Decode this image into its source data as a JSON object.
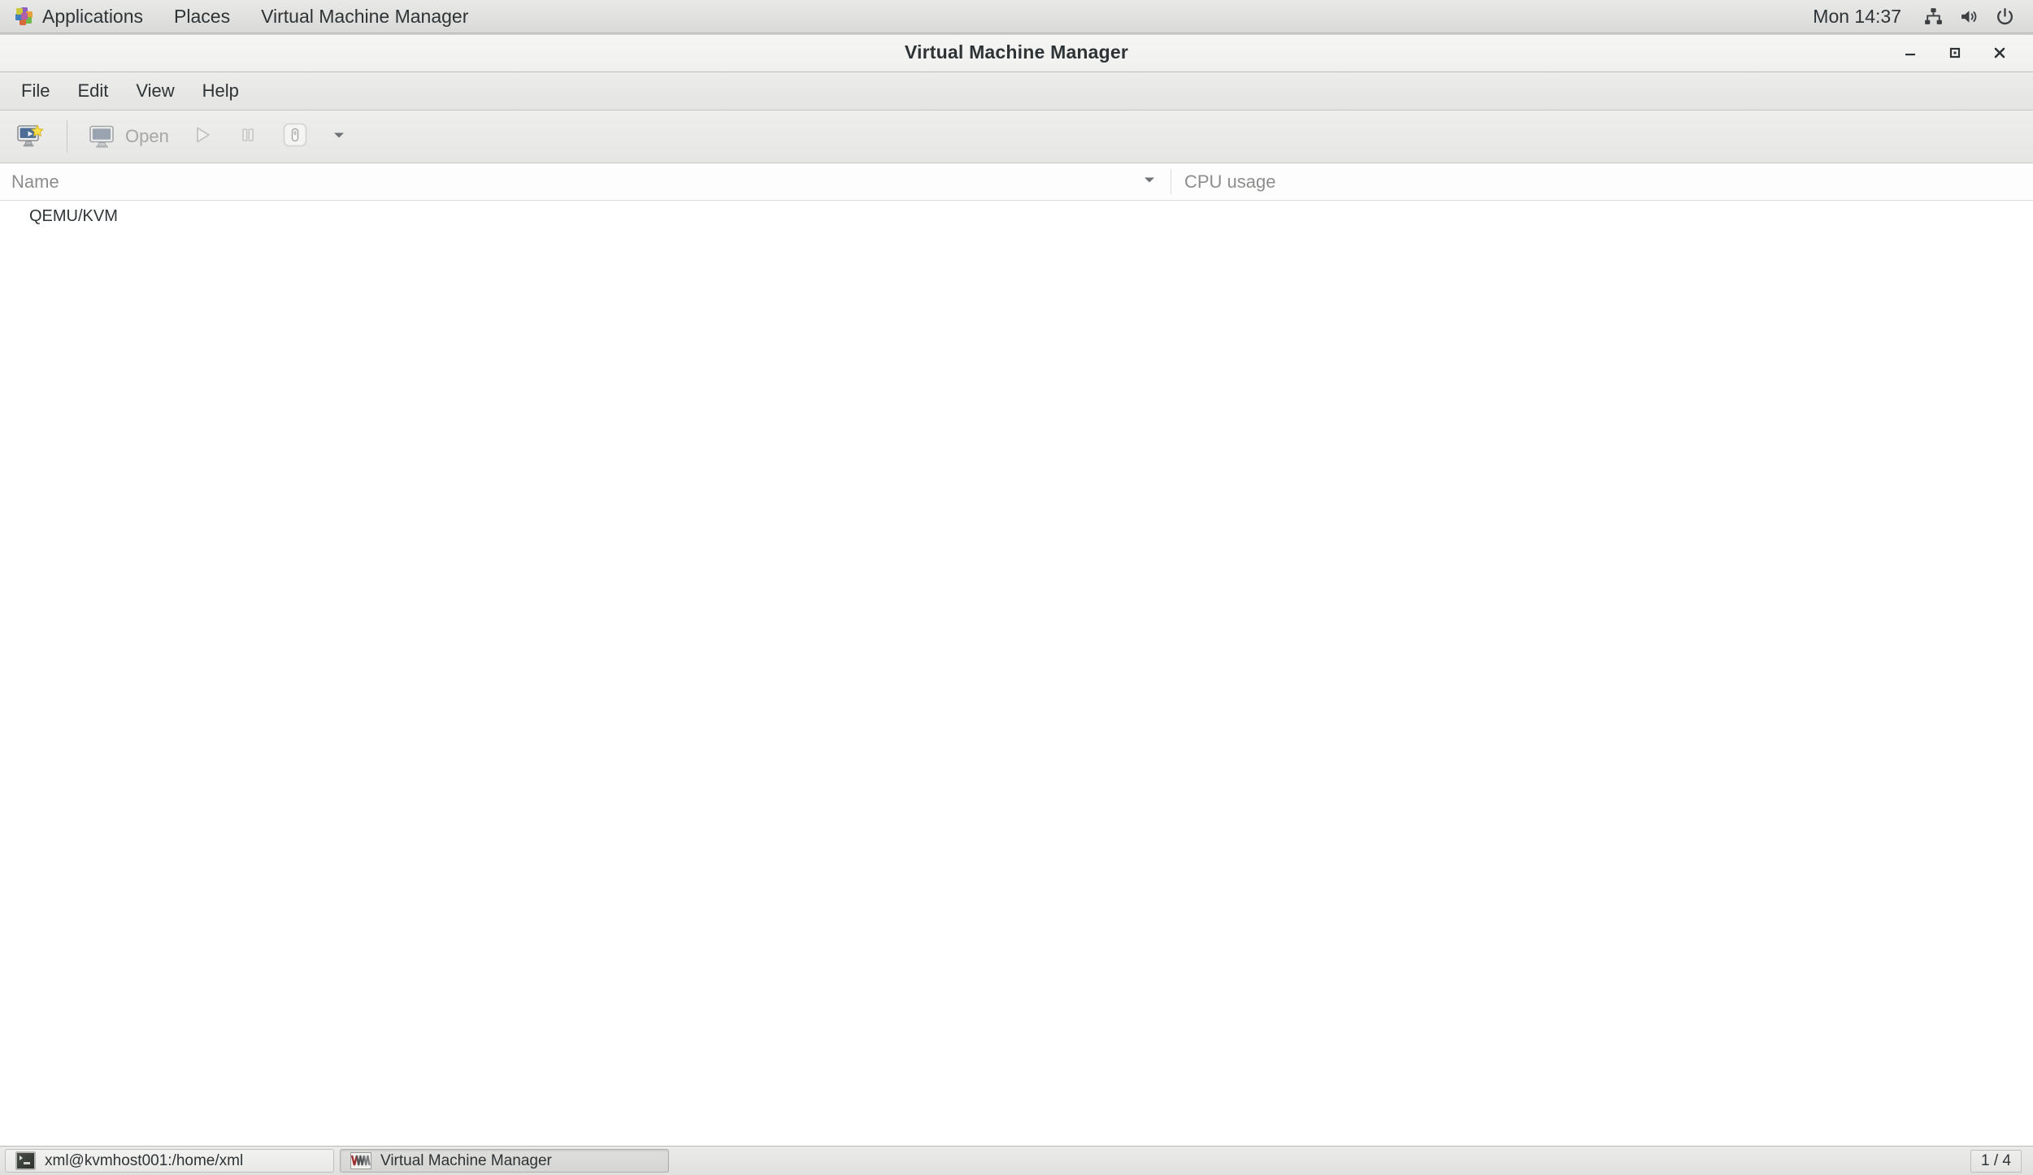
{
  "top_panel": {
    "apps_label": "Applications",
    "places_label": "Places",
    "window_menu_label": "Virtual Machine Manager",
    "clock": "Mon 14:37",
    "tray": [
      {
        "name": "network-icon",
        "title": "Network"
      },
      {
        "name": "volume-icon",
        "title": "Volume"
      },
      {
        "name": "power-icon",
        "title": "Power"
      }
    ]
  },
  "window": {
    "title": "Virtual Machine Manager",
    "controls": {
      "minimize": "Minimize",
      "maximize": "Maximize",
      "close": "Close"
    }
  },
  "menubar": {
    "items": [
      {
        "label": "File"
      },
      {
        "label": "Edit"
      },
      {
        "label": "View"
      },
      {
        "label": "Help"
      }
    ]
  },
  "toolbar": {
    "new_vm_label": "Create a new virtual machine",
    "open_label": "Open",
    "run_label": "Run",
    "pause_label": "Pause",
    "shutdown_label": "Shut down",
    "dropdown_label": "Shutdown options"
  },
  "table": {
    "columns": [
      {
        "label": "Name"
      },
      {
        "label": "CPU usage"
      }
    ],
    "rows": [
      {
        "name": "QEMU/KVM",
        "cpu": ""
      }
    ]
  },
  "taskbar": {
    "items": [
      {
        "label": "xml@kvmhost001:/home/xml",
        "icon": "terminal-icon",
        "active": false
      },
      {
        "label": "Virtual Machine Manager",
        "icon": "vmm-icon",
        "active": true
      }
    ],
    "workspace": "1 / 4"
  },
  "colors": {
    "panel_bg": "#e0e0df",
    "titlebar_bg": "#f2f2f1",
    "menubar_bg": "#e6e6e5",
    "toolbar_bg": "#e9e9e8",
    "list_bg": "#ffffff",
    "text": "#2e3436",
    "muted_text": "#8d8d8b",
    "disabled_text": "#a6a6a4",
    "border": "#c2c2bf",
    "star_yellow": "#f5e35a"
  }
}
